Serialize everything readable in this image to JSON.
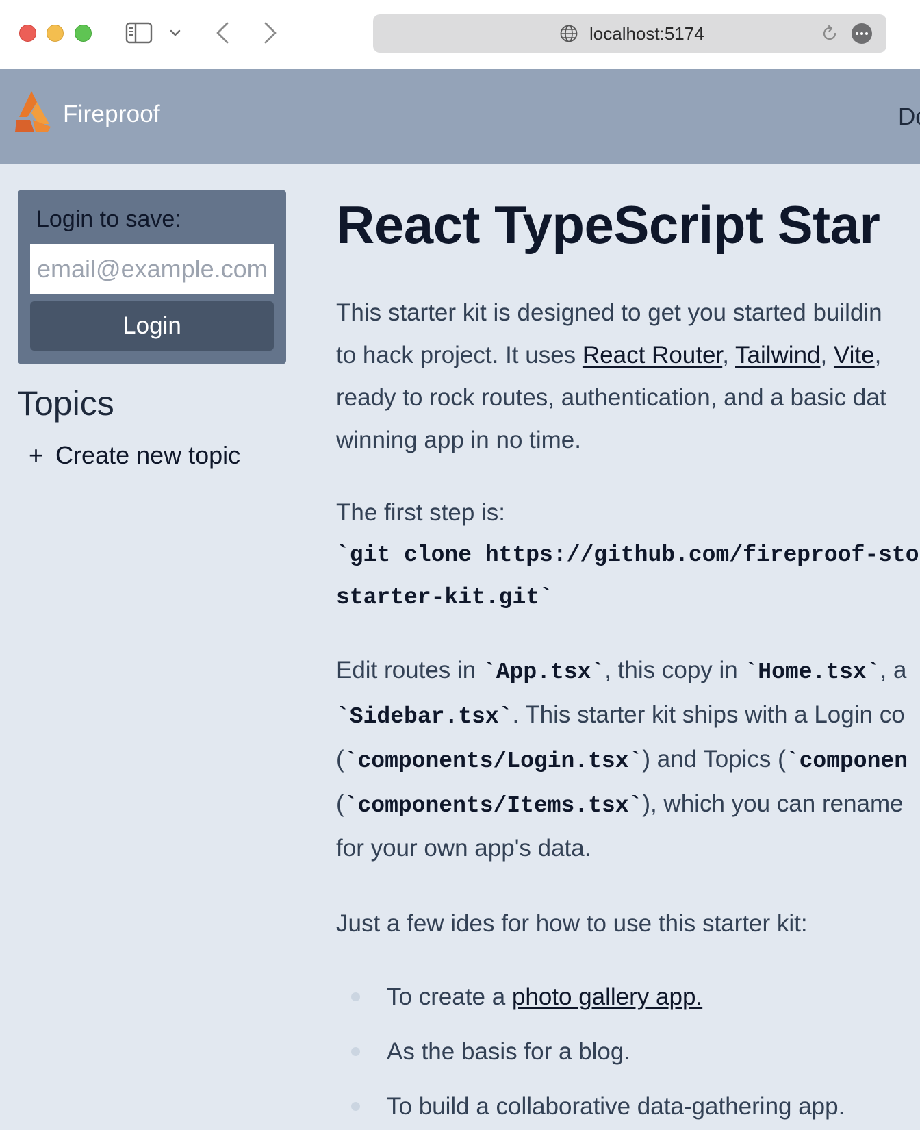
{
  "browser": {
    "url": "localhost:5174"
  },
  "header": {
    "brand": "Fireproof",
    "nav_partial": "Do"
  },
  "sidebar": {
    "login": {
      "title": "Login to save:",
      "email_placeholder": "email@example.com",
      "button_label": "Login"
    },
    "topics_title": "Topics",
    "create_topic_icon": "+",
    "create_topic_label": "Create new topic"
  },
  "main": {
    "title": "React TypeScript Star",
    "p1": {
      "line1": "This starter kit is designed to get you started buildin",
      "line2_a": "to hack project. It uses ",
      "link_react_router": "React Router",
      "sep1": ", ",
      "link_tailwind": "Tailwind",
      "sep2": ", ",
      "link_vite": "Vite",
      "line2_end": ",",
      "line3": "ready to rock routes, authentication, and a basic dat",
      "line4": "winning app in no time."
    },
    "p2": {
      "line1": "The first step is:",
      "code_line1": "`git clone https://github.com/fireproof-sto",
      "code_line2": "starter-kit.git`"
    },
    "p3": {
      "l1_a": "Edit routes in ",
      "l1_code1": "`App.tsx`",
      "l1_b": ", this copy in ",
      "l1_code2": "`Home.tsx`",
      "l1_c": ", a",
      "l2_code": "`Sidebar.tsx`",
      "l2_b": ". This starter kit ships with a Login co",
      "l3_a": "(",
      "l3_code1": "`components/Login.tsx`",
      "l3_b": ") and Topics (",
      "l3_code2": "`componen",
      "l4_a": "(",
      "l4_code": "`components/Items.tsx`",
      "l4_b": "), which you can rename",
      "l5": "for your own app's data."
    },
    "p4": "Just a few ides for how to use this starter kit:",
    "ideas": {
      "i1_a": "To create a ",
      "i1_link": "photo gallery app.",
      "i2": "As the basis for a blog.",
      "i3": "To build a collaborative data-gathering app."
    }
  }
}
